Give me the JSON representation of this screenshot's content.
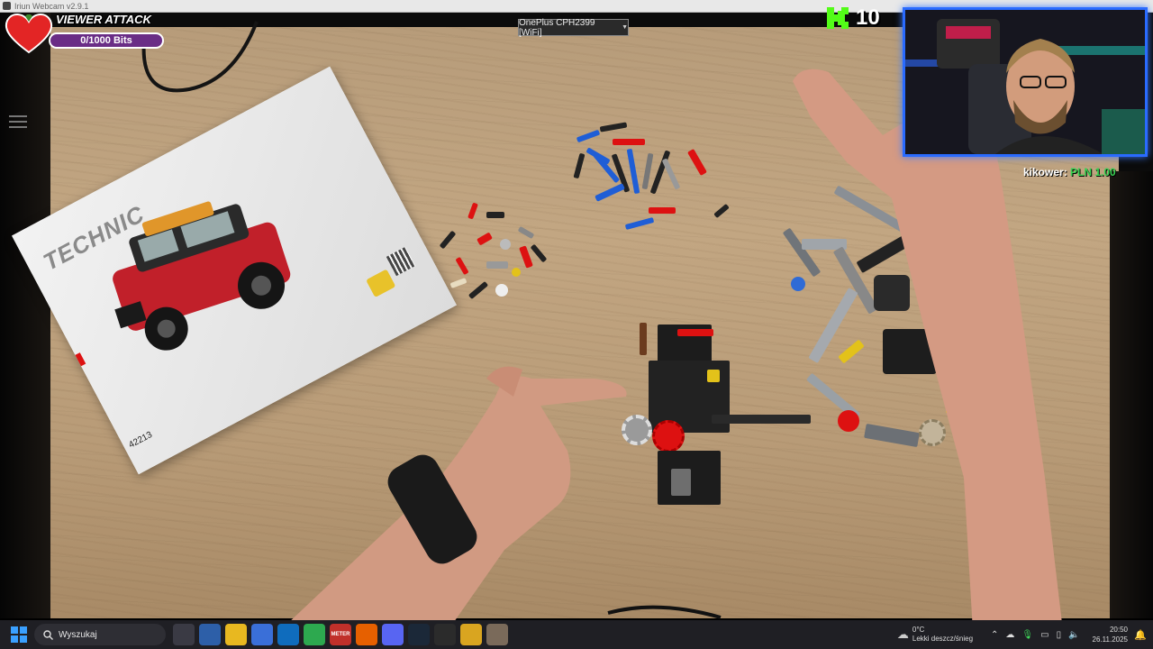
{
  "window": {
    "title": "Iriun Webcam v2.9.1"
  },
  "device_selector": {
    "label": "OnePlus CPH2399 [WiFi]"
  },
  "booklet": {
    "title": "TECHNIC",
    "set_number": "42213"
  },
  "viewer_attack": {
    "title": "VIEWER ATTACK",
    "progress_text": "0/1000 Bits",
    "progress_fraction": 0.0,
    "heart_color": "#e32525",
    "bar_color": "#6a2d86"
  },
  "kick": {
    "logo_color": "#53fc18",
    "count": "10"
  },
  "webcam": {
    "border_color": "#2a6bff"
  },
  "donation": {
    "user": "kikower:",
    "amount": "PLN 1.00"
  },
  "taskbar": {
    "search_placeholder": "Wyszukaj",
    "pinned_apps": [
      {
        "name": "task-view",
        "color": "#3a3a44"
      },
      {
        "name": "app-tool",
        "color": "#2d5fa8"
      },
      {
        "name": "file-explorer",
        "color": "#e8b820"
      },
      {
        "name": "microsoft-store",
        "color": "#3a6fd8"
      },
      {
        "name": "outlook",
        "color": "#0f6cbd"
      },
      {
        "name": "chrome",
        "color": "#2da94f"
      },
      {
        "name": "stream-meter",
        "color": "#c0302a"
      },
      {
        "name": "firefox",
        "color": "#e66000"
      },
      {
        "name": "discord",
        "color": "#5865f2"
      },
      {
        "name": "steam",
        "color": "#1b2838"
      },
      {
        "name": "obs",
        "color": "#2b2b2b"
      },
      {
        "name": "app-yellow",
        "color": "#d9a520"
      },
      {
        "name": "app-grey",
        "color": "#7a6a5a"
      }
    ],
    "stream_meter_label": "METER",
    "weather": {
      "temp": "0°C",
      "condition": "Lekki deszcz/śnieg"
    },
    "clock": {
      "time": "20:50",
      "date": "26.11.2025"
    }
  }
}
